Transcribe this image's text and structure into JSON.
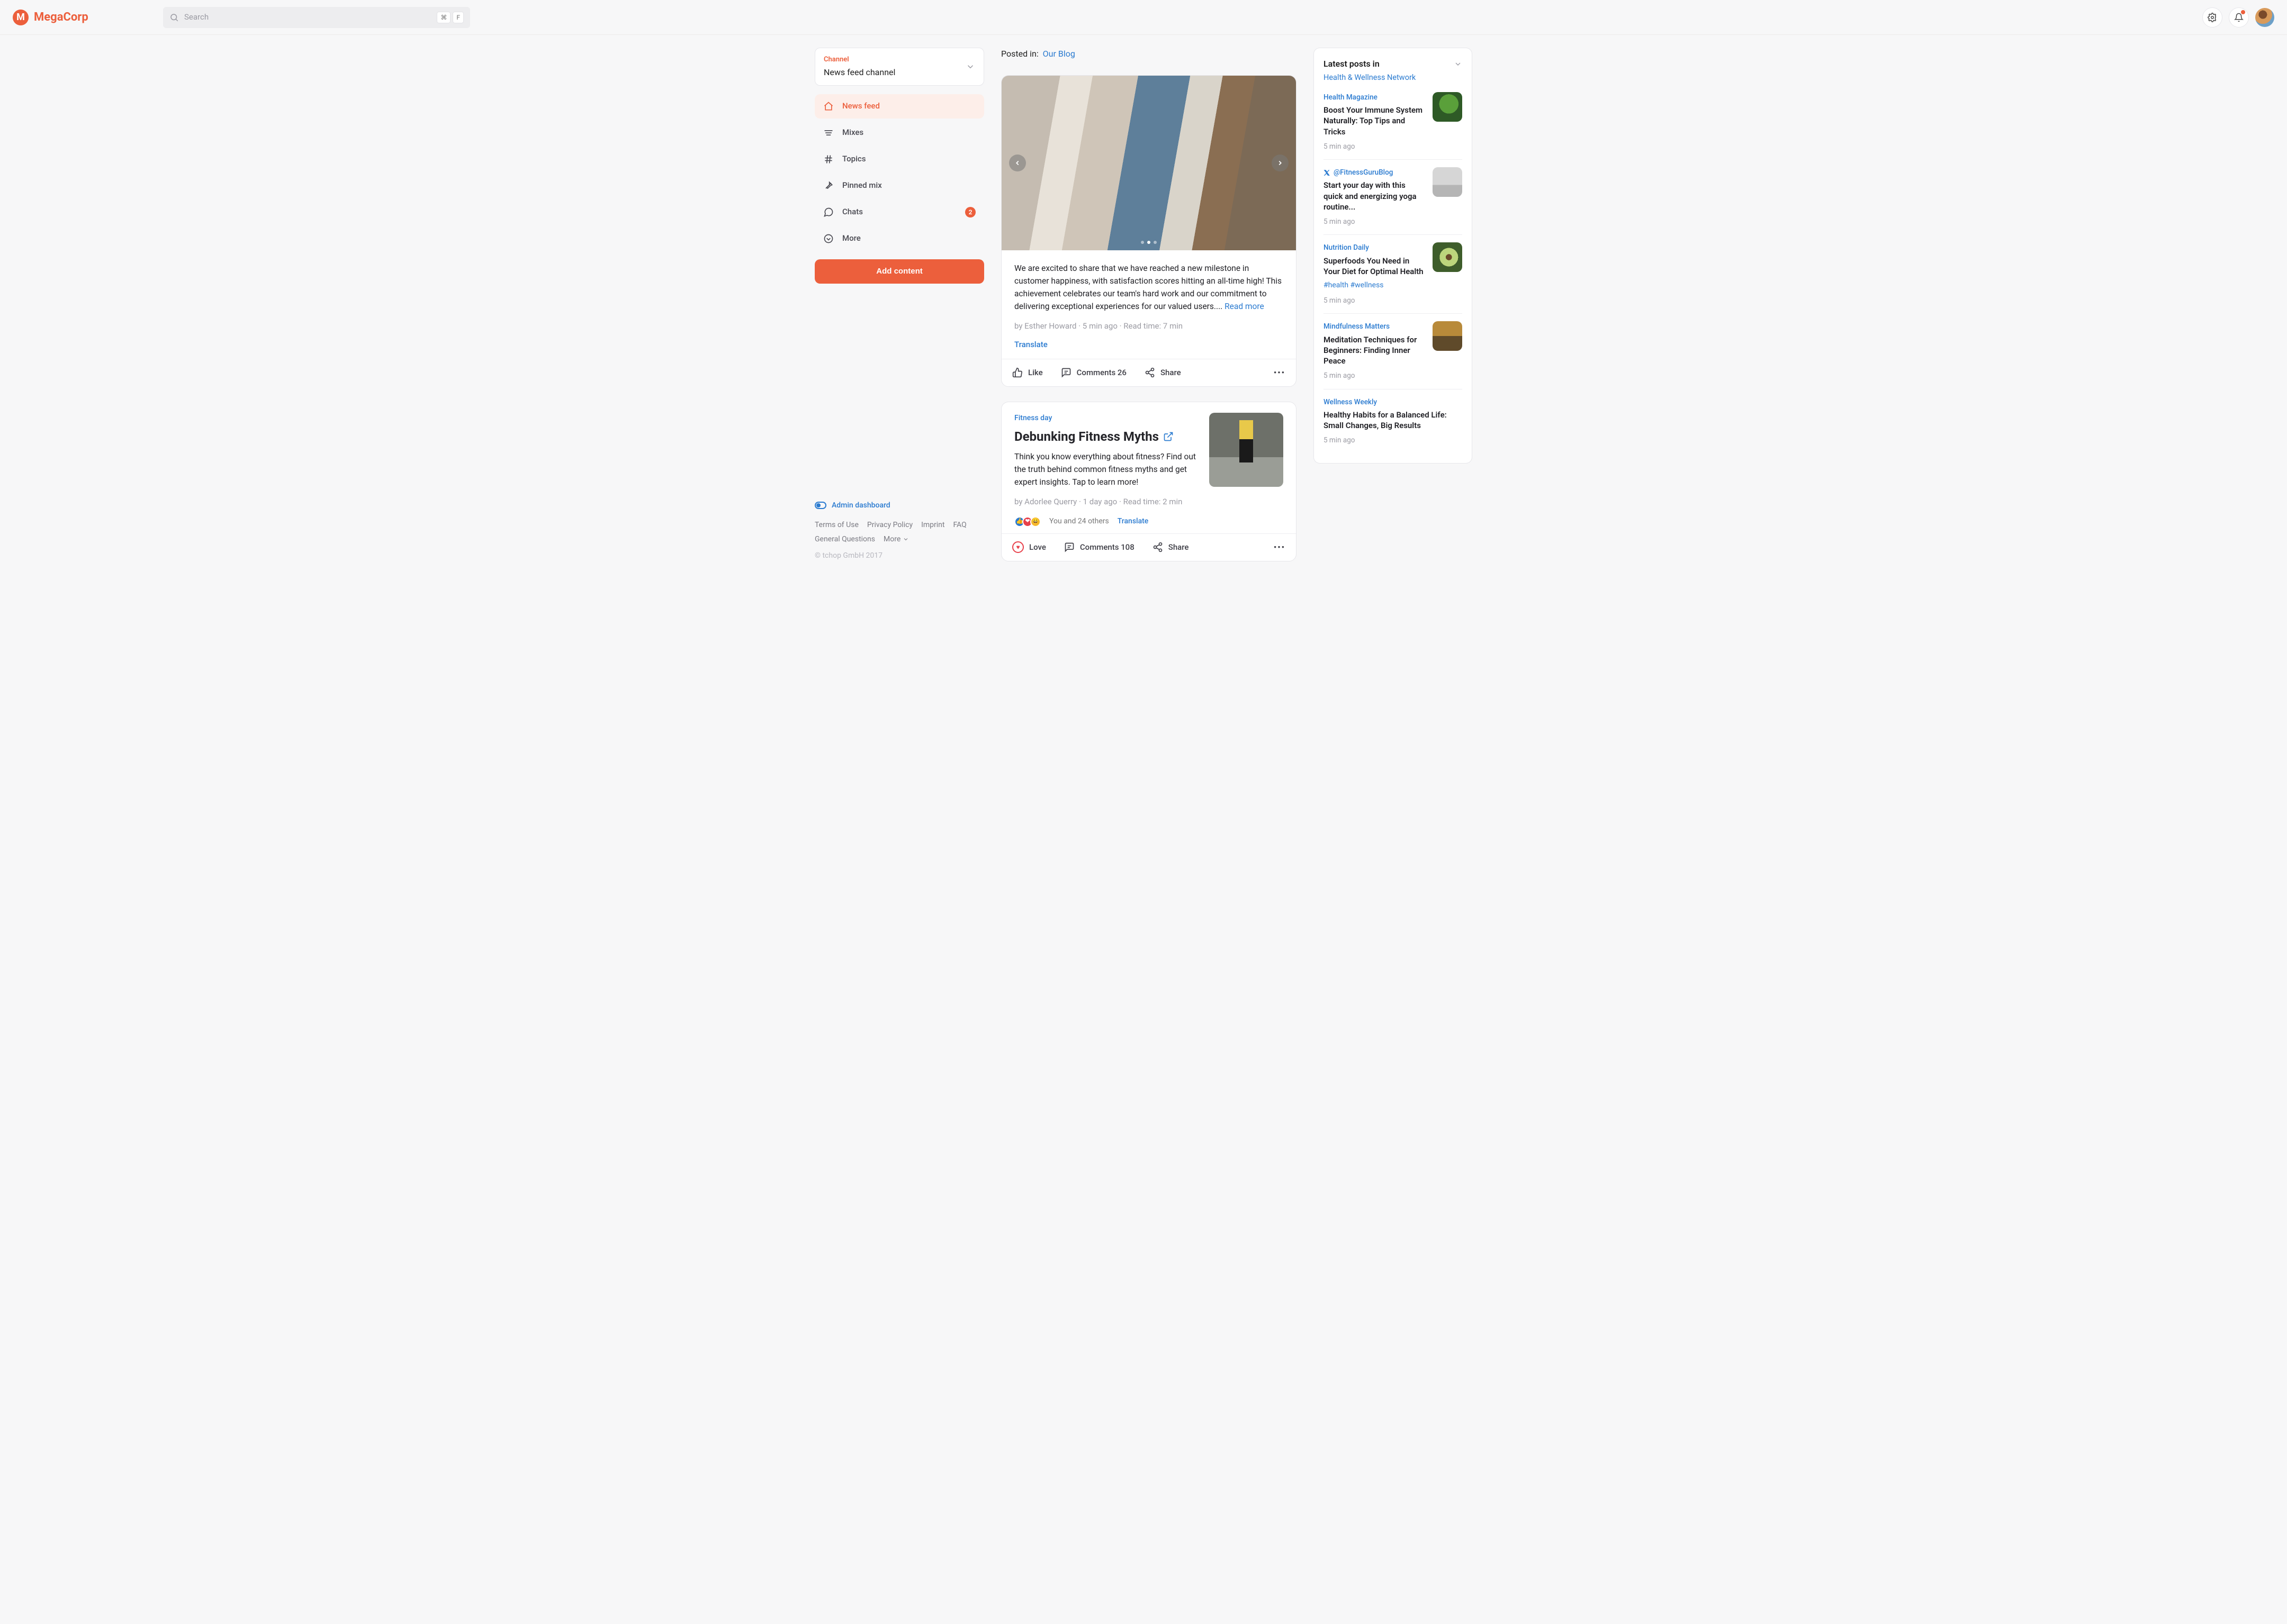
{
  "brand": {
    "name": "MegaCorp",
    "initial": "M"
  },
  "search": {
    "placeholder": "Search",
    "kbd1": "⌘",
    "kbd2": "F"
  },
  "sidebar": {
    "channel_label": "Channel",
    "channel_value": "News feed channel",
    "nav": {
      "newsfeed": "News feed",
      "mixes": "Mixes",
      "topics": "Topics",
      "pinned": "Pinned mix",
      "chats": "Chats",
      "chats_badge": "2",
      "more": "More"
    },
    "add_content": "Add content",
    "admin_dashboard": "Admin dashboard",
    "footer": {
      "terms": "Terms of Use",
      "privacy": "Privacy Policy",
      "imprint": "Imprint",
      "faq": "FAQ",
      "general": "General Questions",
      "more": "More"
    },
    "copyright": "© tchop GmbH 2017"
  },
  "feed": {
    "posted_in_label": "Posted in:",
    "posted_in_link": "Our Blog",
    "post1": {
      "desc": "We are excited to share that we have reached a new milestone in customer happiness, with satisfaction scores hitting an all-time high! This achievement celebrates our team's hard work and our commitment to delivering exceptional experiences for our valued users....",
      "read_more": "Read more",
      "meta": "by Esther Howard · 5 min ago · Read time: 7 min",
      "translate": "Translate",
      "like": "Like",
      "comments": "Comments 26",
      "share": "Share"
    },
    "post2": {
      "tag": "Fitness day",
      "title": "Debunking Fitness Myths",
      "desc": "Think you know everything about fitness? Find out the truth behind common fitness myths and get expert insights. Tap to learn more!",
      "meta": "by Adorlee Querry · 1 day ago · Read time: 2 min",
      "reactions_text": "You and 24 others",
      "translate": "Translate",
      "love": "Love",
      "comments": "Comments 108",
      "share": "Share"
    }
  },
  "right": {
    "title": "Latest posts in",
    "channel": "Health & Wellness Network",
    "items": [
      {
        "source": "Health Magazine",
        "title": "Boost Your Immune System Naturally: Top Tips and Tricks",
        "time": "5 min ago",
        "thumb": "th-green"
      },
      {
        "source": "@FitnessGuruBlog",
        "twitter": true,
        "title": "Start your day with this quick and energizing yoga routine...",
        "time": "5 min ago",
        "thumb": "th-grey"
      },
      {
        "source": "Nutrition Daily",
        "title": "Superfoods You Need in Your Diet for Optimal Health",
        "hash": "#health #wellness",
        "time": "5 min ago",
        "thumb": "th-avocado"
      },
      {
        "source": "Mindfulness Matters",
        "title": "Meditation Techniques for Beginners: Finding Inner Peace",
        "time": "5 min ago",
        "thumb": "th-bowls"
      },
      {
        "source": "Wellness Weekly",
        "title": "Healthy Habits for a Balanced Life: Small Changes, Big Results",
        "time": "5 min ago"
      }
    ]
  }
}
